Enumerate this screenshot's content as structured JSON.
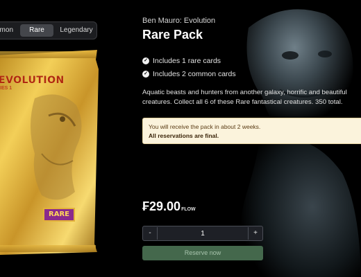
{
  "tabs": [
    {
      "label": "mon",
      "active": false
    },
    {
      "label": "Rare",
      "active": true
    },
    {
      "label": "Legendary",
      "active": false
    }
  ],
  "pack_art": {
    "title": "EVOLUTION",
    "subtitle": "IES 1",
    "badge": "RARE"
  },
  "artist": "Ben Mauro: Evolution",
  "pack_name": "Rare Pack",
  "features": [
    {
      "icon": "check-circle-icon",
      "text": "Includes 1 rare cards"
    },
    {
      "icon": "check-circle-icon",
      "text": "Includes 2 common cards"
    }
  ],
  "description": "Aquatic beasts and hunters from another galaxy, horrific and beautiful creatures. Collect all 6 of these Rare fantastical creatures. 350 total.",
  "notice": {
    "line1": "You will receive the pack in about 2 weeks.",
    "line2": "All reservations are final."
  },
  "price": {
    "amount": "₣29.00",
    "currency": "FLOW"
  },
  "quantity": {
    "minus": "-",
    "value": "1",
    "plus": "+"
  },
  "reserve_label": "Reserve now",
  "colors": {
    "background": "#000000",
    "notice_bg": "#fbf3dc",
    "reserve_bg": "#44684c",
    "active_tab": "#44464b"
  }
}
